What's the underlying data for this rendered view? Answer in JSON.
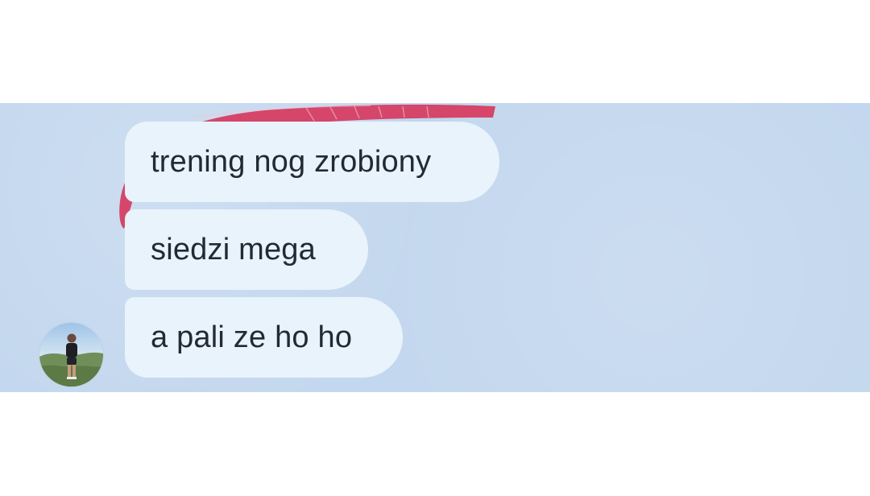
{
  "chat": {
    "messages": [
      {
        "text": "trening nog zrobiony"
      },
      {
        "text": "siedzi mega"
      },
      {
        "text": "a pali ze ho ho"
      }
    ]
  },
  "colors": {
    "chat_background": "#c3d7ee",
    "bubble_background": "#e8f3fb",
    "bubble_text": "#222a33",
    "decor_accent": "#d63a5e"
  },
  "icons": {
    "avatar": "user-avatar-photo",
    "decor": "lips-sticker-icon"
  }
}
